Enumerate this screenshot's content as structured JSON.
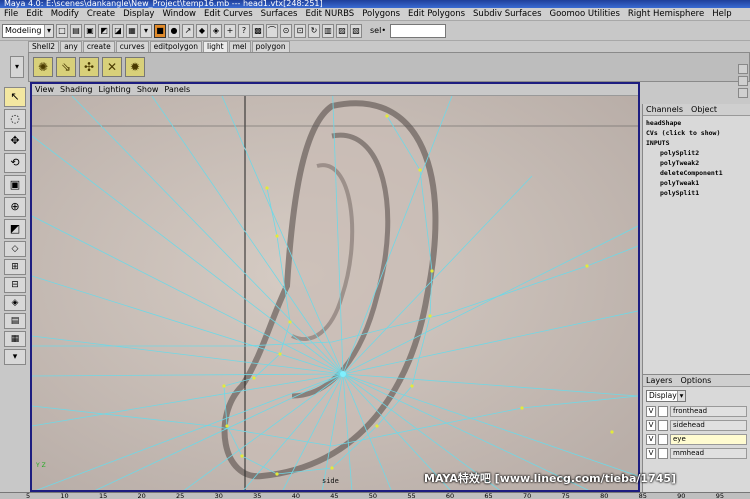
{
  "window": {
    "title": "Maya 4.0: E:\\scenes\\dankangle\\New_Project\\temp16.mb  ---  head1.vtx[248:251]"
  },
  "menubar": [
    "File",
    "Edit",
    "Modify",
    "Create",
    "Display",
    "Window",
    "Edit Curves",
    "Surfaces",
    "Edit NURBS",
    "Polygons",
    "Edit Polygons",
    "Subdiv Surfaces",
    "Goomoo Utilities",
    "Right Hemisphere",
    "Help"
  ],
  "status": {
    "mode": "Modeling",
    "sel_label": "sel•"
  },
  "shelf": {
    "tabs": [
      "Shell2",
      "any",
      "create",
      "curves",
      "editpolygon",
      "light",
      "mel",
      "polygon"
    ],
    "active": "light"
  },
  "viewport": {
    "menus": [
      "View",
      "Shading",
      "Lighting",
      "Show",
      "Panels"
    ],
    "camera": "side",
    "axis_z": "Z",
    "axis_y": "Y"
  },
  "channels": {
    "tabs": [
      "Channels",
      "Object"
    ],
    "object": "headShape",
    "cvs": "CVs (click to show)",
    "inputs_label": "INPUTS",
    "inputs": [
      "polySplit2",
      "polyTweak2",
      "deleteComponent1",
      "polyTweak1",
      "polySplit1"
    ]
  },
  "layers": {
    "tabs": [
      "Layers",
      "Options"
    ],
    "display": "Display",
    "rows": [
      {
        "v": "V",
        "name": "fronthead"
      },
      {
        "v": "V",
        "name": "sidehead"
      },
      {
        "v": "V",
        "name": "eye"
      },
      {
        "v": "V",
        "name": "mmhead"
      }
    ]
  },
  "timeline": [
    "5",
    "10",
    "15",
    "20",
    "25",
    "30",
    "35",
    "40",
    "45",
    "50",
    "55",
    "60",
    "65",
    "70",
    "75",
    "80",
    "85",
    "90",
    "95"
  ],
  "watermark": "MAYA特效吧 [www.linecg.com/tieba/1745]"
}
